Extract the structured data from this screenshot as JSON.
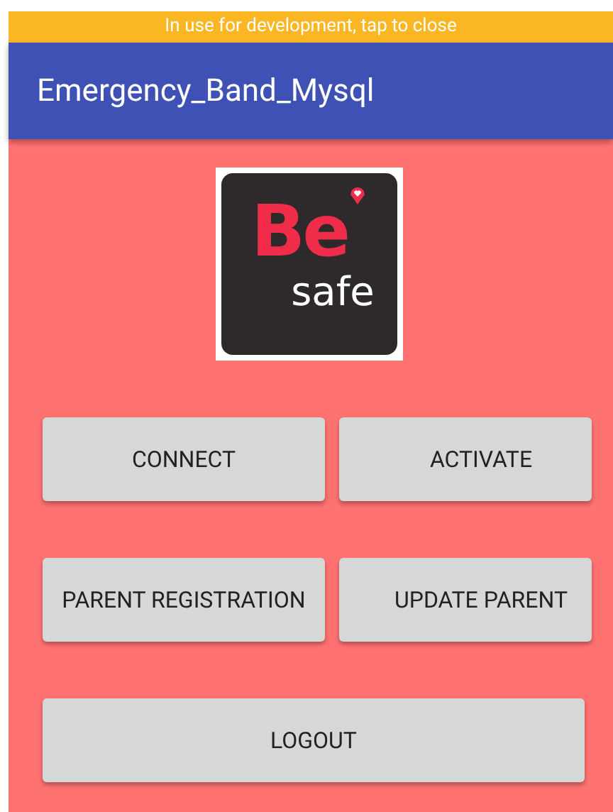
{
  "banner": {
    "text": "In use for development, tap to close"
  },
  "toolbar": {
    "title": "Emergency_Band_Mysql"
  },
  "logo": {
    "mark": "Be",
    "word": "safe"
  },
  "buttons": [
    {
      "label": "CONNECT",
      "kind": "full"
    },
    {
      "label": "ACTIVATE",
      "kind": "clipped"
    },
    {
      "label": "PARENT REGISTRATION",
      "kind": "full"
    },
    {
      "label": "UPDATE PARENT",
      "kind": "clipped"
    },
    {
      "label": "LOGOUT",
      "kind": "wide"
    }
  ]
}
